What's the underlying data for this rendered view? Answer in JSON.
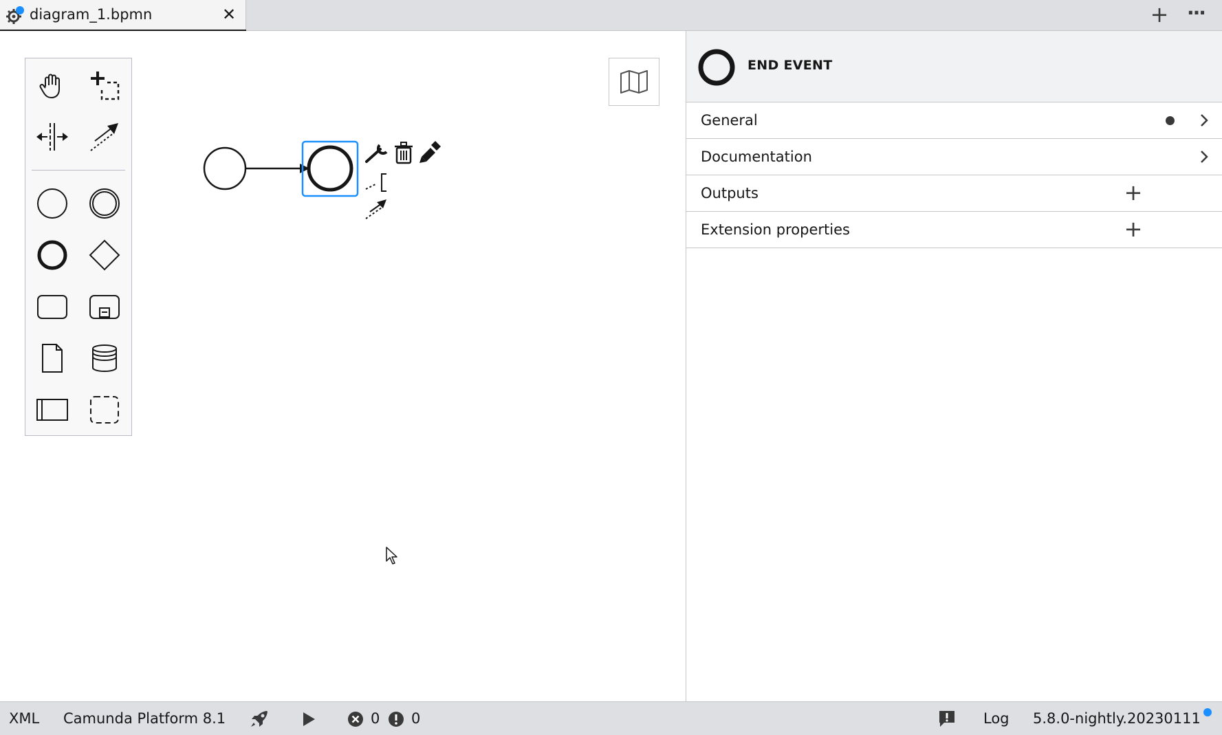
{
  "tab": {
    "title": "diagram_1.bpmn",
    "close_label": "✕",
    "icon": "bpmn-gear-icon",
    "unsaved_indicator_color": "#1a8fff"
  },
  "tabbar": {
    "add_label": "+",
    "more_label": "···"
  },
  "palette": {
    "tools": [
      {
        "name": "hand-tool-icon"
      },
      {
        "name": "lasso-tool-icon"
      },
      {
        "name": "space-tool-icon"
      },
      {
        "name": "global-connect-tool-icon"
      },
      {
        "name": "start-event-icon"
      },
      {
        "name": "intermediate-event-icon"
      },
      {
        "name": "end-event-icon"
      },
      {
        "name": "gateway-icon"
      },
      {
        "name": "task-icon"
      },
      {
        "name": "subprocess-icon"
      },
      {
        "name": "data-object-icon"
      },
      {
        "name": "data-store-icon"
      },
      {
        "name": "participant-icon"
      },
      {
        "name": "group-icon"
      }
    ]
  },
  "diagram": {
    "selection_color": "#1a8fff",
    "context_pad": [
      "wrench-icon",
      "trash-icon",
      "paint-brush-icon",
      "text-annotation-icon",
      "connect-icon"
    ]
  },
  "properties": {
    "header_title": "END EVENT",
    "groups": [
      {
        "label": "General",
        "has_dot": true,
        "action": "chevron"
      },
      {
        "label": "Documentation",
        "has_dot": false,
        "action": "chevron"
      },
      {
        "label": "Outputs",
        "has_dot": false,
        "action": "add"
      },
      {
        "label": "Extension properties",
        "has_dot": false,
        "action": "add"
      }
    ],
    "add_label": "+"
  },
  "statusbar": {
    "xml_label": "XML",
    "platform_label": "Camunda Platform 8.1",
    "error_count": "0",
    "warning_count": "0",
    "log_label": "Log",
    "version_label": "5.8.0-nightly.20230111",
    "version_dot_color": "#1a8fff"
  }
}
